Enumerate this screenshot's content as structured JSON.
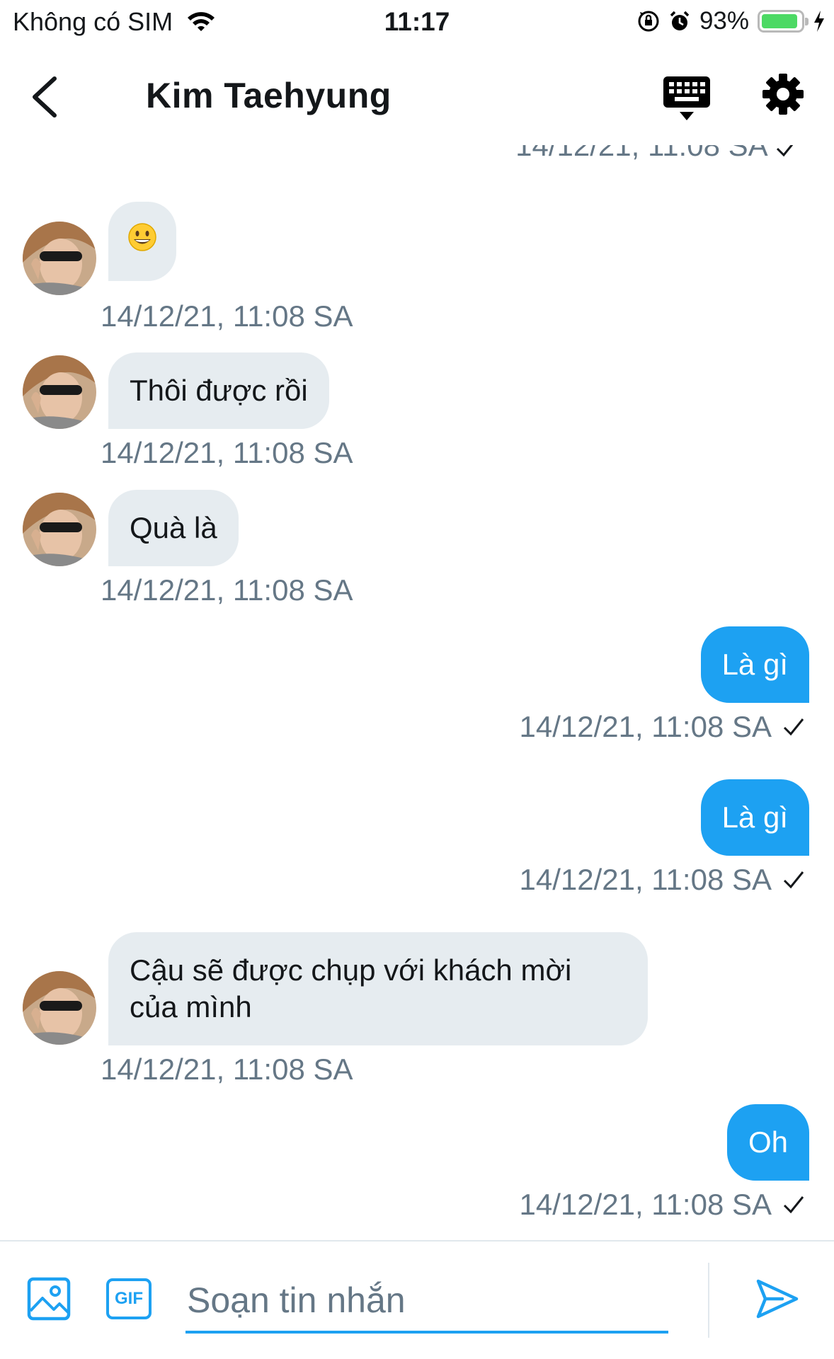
{
  "status_bar": {
    "carrier": "Không có SIM",
    "time": "11:17",
    "battery_percent": "93%",
    "battery_level": 0.93,
    "battery_color": "#4cd964"
  },
  "header": {
    "contact_name": "Kim Taehyung",
    "back_icon": "chevron-left-icon",
    "keyboard_icon": "keyboard-icon",
    "settings_icon": "gear-icon"
  },
  "colors": {
    "accent": "#1da1f2",
    "incoming_bubble": "#e6ecf0",
    "timestamp": "#657786"
  },
  "messages": [
    {
      "direction": "out",
      "text": "",
      "timestamp": "14/12/21, 11:08 SA",
      "cut_off": true
    },
    {
      "direction": "in",
      "emoji": "grinning-face",
      "timestamp": "14/12/21, 11:08 SA"
    },
    {
      "direction": "in",
      "text": "Thôi được rồi",
      "timestamp": "14/12/21, 11:08 SA"
    },
    {
      "direction": "in",
      "text": "Quà là",
      "timestamp": "14/12/21, 11:08 SA"
    },
    {
      "direction": "out",
      "text": "Là gì",
      "timestamp": "14/12/21, 11:08 SA"
    },
    {
      "direction": "out",
      "text": "Là gì",
      "timestamp": "14/12/21, 11:08 SA"
    },
    {
      "direction": "in",
      "text_line1": "Cậu sẽ được chụp với khách mời",
      "text_line2": "của mình",
      "timestamp": "14/12/21, 11:08 SA"
    },
    {
      "direction": "out",
      "text": "Oh",
      "timestamp": "14/12/21, 11:08 SA"
    }
  ],
  "composer": {
    "placeholder": "Soạn tin nhắn",
    "value": "",
    "gif_label": "GIF",
    "image_icon": "image-icon",
    "send_icon": "send-icon"
  }
}
